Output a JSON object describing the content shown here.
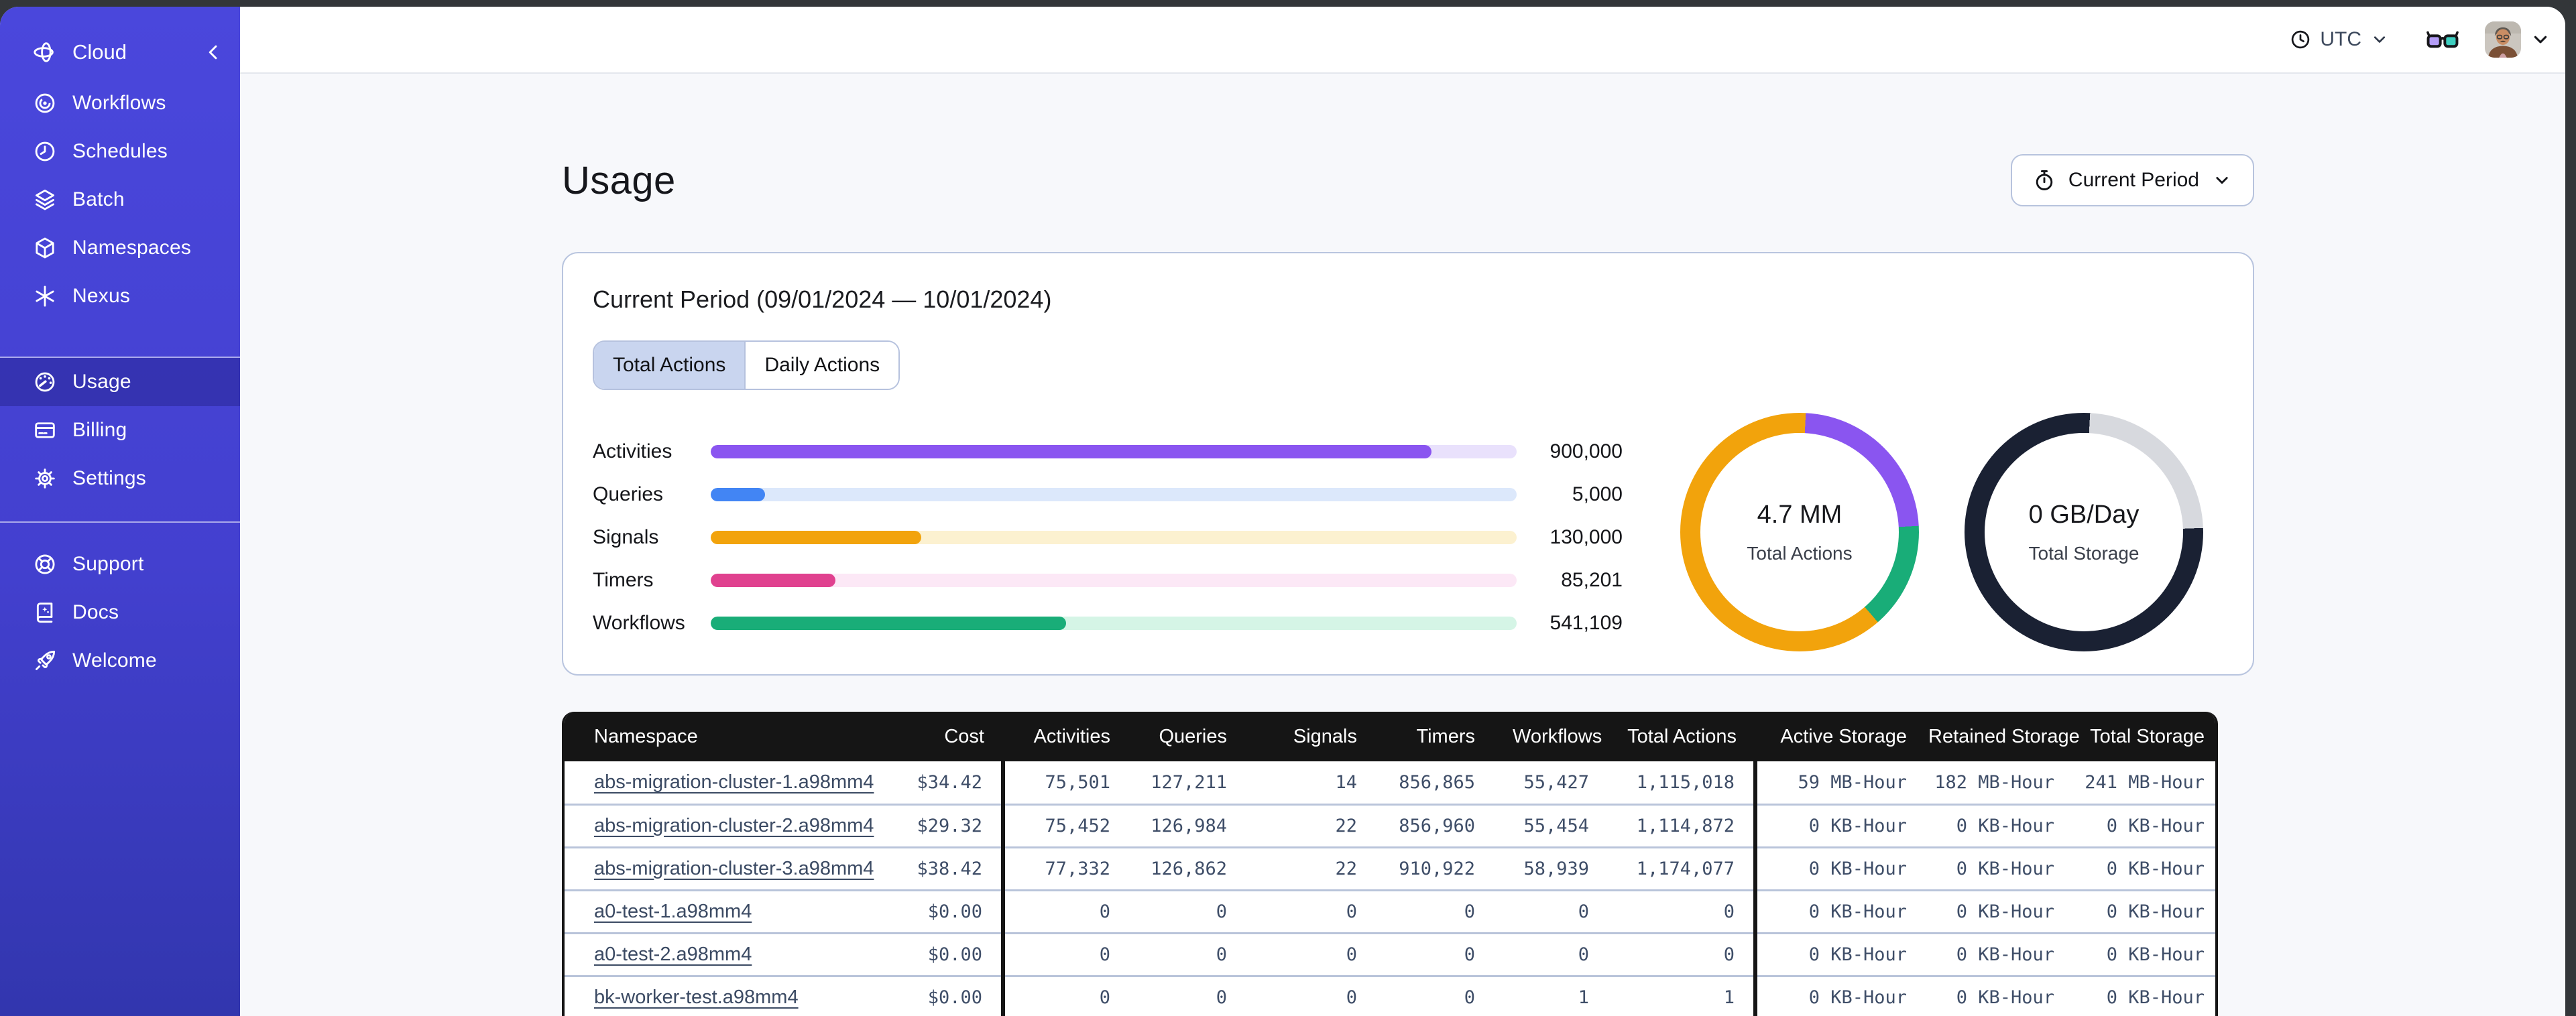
{
  "chrome": {
    "frame_color": "#333639"
  },
  "sidebar": {
    "brand": {
      "label": "Cloud"
    },
    "groups": [
      {
        "items": [
          {
            "label": "Workflows",
            "icon": "workflows-icon",
            "selected": false
          },
          {
            "label": "Schedules",
            "icon": "schedules-icon",
            "selected": false
          },
          {
            "label": "Batch",
            "icon": "batch-icon",
            "selected": false
          },
          {
            "label": "Namespaces",
            "icon": "namespaces-icon",
            "selected": false
          },
          {
            "label": "Nexus",
            "icon": "nexus-icon",
            "selected": false
          }
        ]
      },
      {
        "items": [
          {
            "label": "Usage",
            "icon": "usage-gauge-icon",
            "selected": true
          },
          {
            "label": "Billing",
            "icon": "billing-card-icon",
            "selected": false
          },
          {
            "label": "Settings",
            "icon": "settings-gear-icon",
            "selected": false
          }
        ]
      },
      {
        "items": [
          {
            "label": "Support",
            "icon": "support-lifebuoy-icon",
            "selected": false
          },
          {
            "label": "Docs",
            "icon": "docs-book-icon",
            "selected": false
          },
          {
            "label": "Welcome",
            "icon": "welcome-rocket-icon",
            "selected": false
          }
        ]
      }
    ]
  },
  "topbar": {
    "timezone": {
      "label": "UTC"
    }
  },
  "page": {
    "title": "Usage"
  },
  "period_button": {
    "label": "Current Period"
  },
  "usage_card": {
    "title": "Current Period (09/01/2024 — 10/01/2024)",
    "tabs": [
      {
        "label": "Total Actions",
        "selected": true
      },
      {
        "label": "Daily Actions",
        "selected": false
      }
    ],
    "bars": [
      {
        "label": "Activities",
        "value": "900,000",
        "raw": 900000,
        "fill_pct": 89.4,
        "color": "#8a55f0",
        "track_color": "#e9e1fc"
      },
      {
        "label": "Queries",
        "value": "5,000",
        "raw": 5000,
        "fill_pct": 6.7,
        "color": "#4285f4",
        "track_color": "#dce8fb"
      },
      {
        "label": "Signals",
        "value": "130,000",
        "raw": 130000,
        "fill_pct": 26.1,
        "color": "#f2a30c",
        "track_color": "#fcf1d0"
      },
      {
        "label": "Timers",
        "value": "85,201",
        "raw": 85201,
        "fill_pct": 15.5,
        "color": "#e0418f",
        "track_color": "#fce8f6"
      },
      {
        "label": "Workflows",
        "value": "541,109",
        "raw": 541109,
        "fill_pct": 44.1,
        "color": "#19ad78",
        "track_color": "#d5f5e6"
      }
    ],
    "donuts": [
      {
        "value": "4.7 MM",
        "label": "Total Actions",
        "rotate_deg": 3,
        "segments": [
          {
            "name": "activities",
            "color": "#8a55f0",
            "from": 0,
            "to": 84
          },
          {
            "name": "workflows",
            "color": "#19ad78",
            "from": 84,
            "to": 136
          },
          {
            "name": "signals",
            "color": "#f2a30c",
            "from": 136,
            "to": 360
          }
        ]
      },
      {
        "value": "0 GB/Day",
        "label": "Total Storage",
        "rotate_deg": 3,
        "segments": [
          {
            "name": "remaining",
            "color": "#d7d9de",
            "from": 0,
            "to": 85
          },
          {
            "name": "used",
            "color": "#1a2133",
            "from": 85,
            "to": 360
          }
        ]
      }
    ]
  },
  "table": {
    "columns": [
      "Namespace",
      "Cost",
      "Activities",
      "Queries",
      "Signals",
      "Timers",
      "Workflows",
      "Total Actions",
      "Active Storage",
      "Retained Storage",
      "Total Storage"
    ],
    "rows": [
      {
        "namespace": "abs-migration-cluster-1.a98mm4",
        "cost": "$34.42",
        "activities": "75,501",
        "queries": "127,211",
        "signals": "14",
        "timers": "856,865",
        "workflows": "55,427",
        "total_actions": "1,115,018",
        "active_storage": "59 MB-Hour",
        "retained_storage": "182 MB-Hour",
        "total_storage": "241 MB-Hour"
      },
      {
        "namespace": "abs-migration-cluster-2.a98mm4",
        "cost": "$29.32",
        "activities": "75,452",
        "queries": "126,984",
        "signals": "22",
        "timers": "856,960",
        "workflows": "55,454",
        "total_actions": "1,114,872",
        "active_storage": "0 KB-Hour",
        "retained_storage": "0 KB-Hour",
        "total_storage": "0 KB-Hour"
      },
      {
        "namespace": "abs-migration-cluster-3.a98mm4",
        "cost": "$38.42",
        "activities": "77,332",
        "queries": "126,862",
        "signals": "22",
        "timers": "910,922",
        "workflows": "58,939",
        "total_actions": "1,174,077",
        "active_storage": "0 KB-Hour",
        "retained_storage": "0 KB-Hour",
        "total_storage": "0 KB-Hour"
      },
      {
        "namespace": "a0-test-1.a98mm4",
        "cost": "$0.00",
        "activities": "0",
        "queries": "0",
        "signals": "0",
        "timers": "0",
        "workflows": "0",
        "total_actions": "0",
        "active_storage": "0 KB-Hour",
        "retained_storage": "0 KB-Hour",
        "total_storage": "0 KB-Hour"
      },
      {
        "namespace": "a0-test-2.a98mm4",
        "cost": "$0.00",
        "activities": "0",
        "queries": "0",
        "signals": "0",
        "timers": "0",
        "workflows": "0",
        "total_actions": "0",
        "active_storage": "0 KB-Hour",
        "retained_storage": "0 KB-Hour",
        "total_storage": "0 KB-Hour"
      },
      {
        "namespace": "bk-worker-test.a98mm4",
        "cost": "$0.00",
        "activities": "0",
        "queries": "0",
        "signals": "0",
        "timers": "0",
        "workflows": "1",
        "total_actions": "1",
        "active_storage": "0 KB-Hour",
        "retained_storage": "0 KB-Hour",
        "total_storage": "0 KB-Hour"
      }
    ]
  },
  "chart_data": [
    {
      "type": "bar",
      "orientation": "horizontal",
      "title": "Current Period action totals",
      "categories": [
        "Activities",
        "Queries",
        "Signals",
        "Timers",
        "Workflows"
      ],
      "values": [
        900000,
        5000,
        130000,
        85201,
        541109
      ]
    },
    {
      "type": "pie",
      "title": "4.7 MM Total Actions",
      "labels": [
        "activities",
        "workflows",
        "signals"
      ],
      "values_deg": [
        84,
        52,
        224
      ]
    },
    {
      "type": "pie",
      "title": "0 GB/Day Total Storage",
      "labels": [
        "remaining",
        "used"
      ],
      "values_deg": [
        85,
        275
      ]
    }
  ]
}
